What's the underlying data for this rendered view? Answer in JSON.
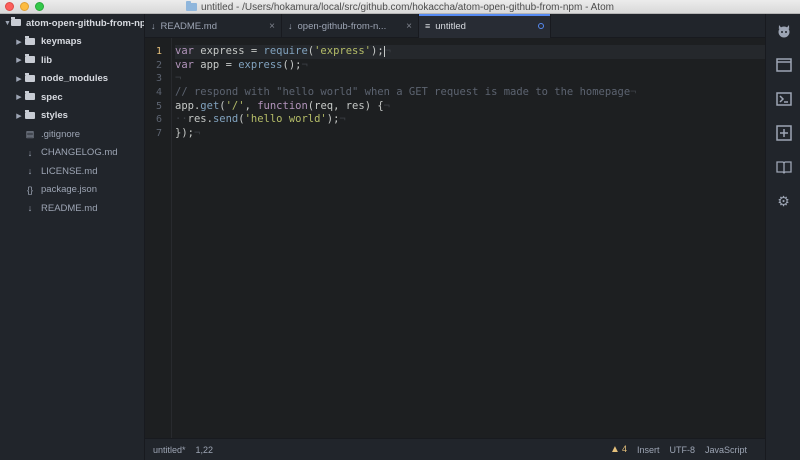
{
  "window": {
    "title": "untitled - /Users/hokamura/local/src/github.com/hokaccha/atom-open-github-from-npm - Atom"
  },
  "tree": {
    "root": "atom-open-github-from-npm",
    "items": [
      {
        "label": "keymaps",
        "type": "dir",
        "icon": "folder-icon"
      },
      {
        "label": "lib",
        "type": "dir",
        "icon": "folder-icon"
      },
      {
        "label": "node_modules",
        "type": "dir",
        "icon": "folder-icon"
      },
      {
        "label": "spec",
        "type": "dir",
        "icon": "folder-icon"
      },
      {
        "label": "styles",
        "type": "dir",
        "icon": "folder-icon"
      },
      {
        "label": ".gitignore",
        "type": "file",
        "icon": "text-file-icon"
      },
      {
        "label": "CHANGELOG.md",
        "type": "file",
        "icon": "markdown-icon"
      },
      {
        "label": "LICENSE.md",
        "type": "file",
        "icon": "markdown-icon"
      },
      {
        "label": "package.json",
        "type": "file",
        "icon": "json-icon"
      },
      {
        "label": "README.md",
        "type": "file",
        "icon": "markdown-icon"
      }
    ]
  },
  "tabs": [
    {
      "label": "README.md",
      "icon": "markdown-icon",
      "active": false
    },
    {
      "label": "open-github-from-n...",
      "icon": "code-file-icon",
      "active": false
    },
    {
      "label": "untitled",
      "icon": "text-file-icon",
      "active": true
    }
  ],
  "editor": {
    "line_numbers": [
      "1",
      "2",
      "3",
      "4",
      "5",
      "6",
      "7"
    ]
  },
  "status": {
    "file": "untitled*",
    "position": "1,22",
    "warnings": "4",
    "mode": "Insert",
    "encoding": "UTF-8",
    "grammar": "JavaScript"
  },
  "toolbar": {
    "buttons": [
      "github-icon",
      "browser-icon",
      "terminal-icon",
      "add-icon",
      "book-icon",
      "gear-icon"
    ]
  },
  "colors": {
    "accent": "#568af2",
    "editor_bg": "#1d1f21",
    "panel_bg": "#21252b",
    "warning": "#e5c07b"
  }
}
